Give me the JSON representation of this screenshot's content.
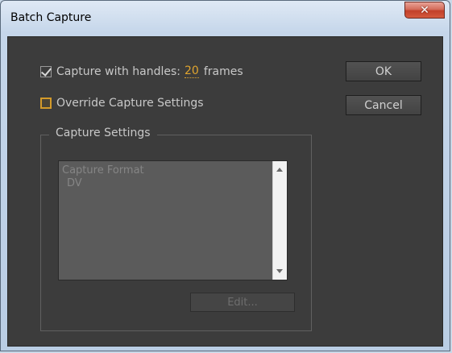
{
  "window": {
    "title": "Batch Capture",
    "close_icon": "close-icon"
  },
  "capture_handles": {
    "label": "Capture with handles:",
    "value": "20",
    "unit": "frames",
    "checked": true
  },
  "override": {
    "label": "Override Capture Settings",
    "checked": false
  },
  "buttons": {
    "ok": "OK",
    "cancel": "Cancel",
    "edit": "Edit..."
  },
  "capture_settings": {
    "title": "Capture Settings",
    "format_label": "Capture Format",
    "format_value": "DV"
  },
  "colors": {
    "accent": "#e0a52f",
    "dialog_bg": "#3c3c3c",
    "close_red": "#c2402a"
  }
}
